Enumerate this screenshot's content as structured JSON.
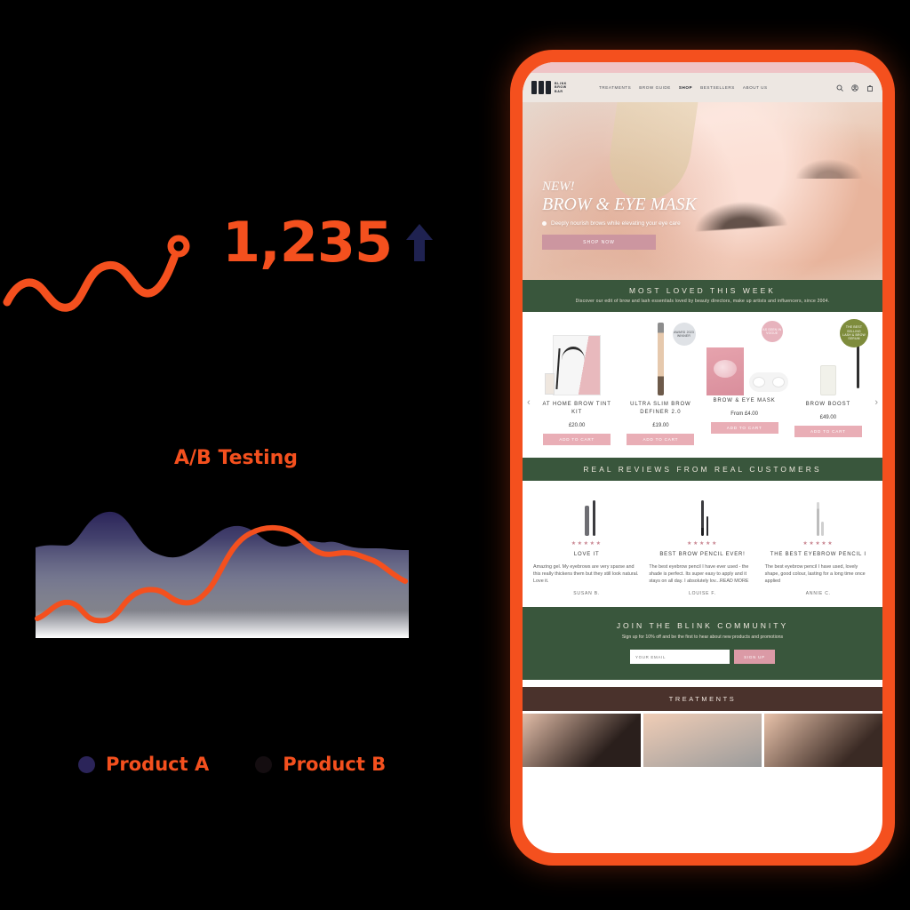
{
  "analytics": {
    "metric_value": "1,235",
    "trend_icon": "arrow-up-icon",
    "trend_color": "#1F2251",
    "accent_color": "#F4501E",
    "section_label": "A/B Testing",
    "legend": [
      {
        "label": "Product A",
        "color": "#2B2459",
        "dot": "legend-dot-product-a"
      },
      {
        "label": "Product B",
        "color": "#140D10",
        "dot": "legend-dot-product-b"
      }
    ]
  },
  "chart_data": {
    "type": "area",
    "title": "A/B Testing",
    "xlabel": "",
    "ylabel": "",
    "grid": false,
    "legend_position": "bottom",
    "xlim": [
      0,
      12
    ],
    "ylim": [
      0,
      100
    ],
    "x": [
      0,
      1,
      2,
      3,
      4,
      5,
      6,
      7,
      8,
      9,
      10,
      11,
      12
    ],
    "series": [
      {
        "name": "Product A",
        "type": "area",
        "color": "#2B2459",
        "fill": "gradient-navy-to-white",
        "values": [
          72,
          76,
          96,
          84,
          66,
          62,
          76,
          80,
          60,
          55,
          60,
          52,
          50
        ]
      },
      {
        "name": "Product B",
        "type": "line",
        "color": "#F4501E",
        "values": [
          21,
          32,
          30,
          21,
          20,
          40,
          43,
          36,
          40,
          78,
          88,
          82,
          72,
          68,
          50
        ]
      }
    ]
  },
  "phone": {
    "frame_color": "#F4501E",
    "site": {
      "header": {
        "logo": {
          "blocks": 3,
          "line1": "BLINK",
          "line2": "BROW",
          "line3": "BAR"
        },
        "nav": [
          {
            "label": "TREATMENTS",
            "active": false
          },
          {
            "label": "BROW GUIDE",
            "active": false
          },
          {
            "label": "SHOP",
            "active": true
          },
          {
            "label": "BESTSELLERS",
            "active": false
          },
          {
            "label": "ABOUT US",
            "active": false
          }
        ],
        "icons": [
          "search-icon",
          "account-icon",
          "bag-icon"
        ]
      },
      "hero": {
        "eyebrow": "NEW!",
        "title": "BROW & EYE MASK",
        "subtitle": "Deeply nourish brows while elevating your eye care",
        "cta": "SHOP NOW"
      },
      "most_loved": {
        "title": "MOST LOVED THIS WEEK",
        "subtitle": "Discover our edit of brow and lash essentials loved by beauty directors, make up artists and influencers, since 2004.",
        "prev": "‹",
        "next": "›",
        "products": [
          {
            "name": "AT HOME BROW TINT KIT",
            "price": "£20.00",
            "cta": "ADD TO CART"
          },
          {
            "name": "ULTRA SLIM BROW DEFINER 2.0",
            "price": "£19.00",
            "cta": "ADD TO CART",
            "badge": "AWARD 2023 WINNER"
          },
          {
            "name": "BROW & EYE MASK",
            "price": "From  £4.00",
            "cta": "ADD TO CART",
            "badge": "AS SEEN IN VOGUE"
          },
          {
            "name": "BROW BOOST",
            "price": "£49.00",
            "cta": "ADD TO CART",
            "badge": "THE BEST SELLING LASH & BROW SERUM"
          }
        ]
      },
      "reviews": {
        "title": "REAL REVIEWS FROM REAL CUSTOMERS",
        "items": [
          {
            "stars": "★★★★★",
            "title": "LOVE IT",
            "body": "Amazing gel. My eyebrows are very sparse and this really thickens them but they still look natural. Love it.",
            "author": "SUSAN B."
          },
          {
            "stars": "★★★★★",
            "title": "BEST BROW PENCIL EVER!",
            "body": "The best eyebrow pencil I have ever used - the shade is perfect. Its super easy to apply and it stays on all day. I absolutely lov...READ MORE",
            "author": "LOUISE F."
          },
          {
            "stars": "★★★★★",
            "title": "THE BEST EYEBROW PENCIL I",
            "body": "The best eyebrow pencil I have used, lovely shape, good colour, lasting for a long time once applied",
            "author": "ANNIE C."
          }
        ]
      },
      "community": {
        "title": "JOIN THE BLINK COMMUNITY",
        "subtitle": "Sign up for 10% off and be the first to hear about new products and promotions",
        "input_placeholder": "YOUR EMAIL",
        "input_value": "",
        "button": "SIGN UP"
      },
      "treatments": {
        "title": "TREATMENTS"
      }
    }
  }
}
